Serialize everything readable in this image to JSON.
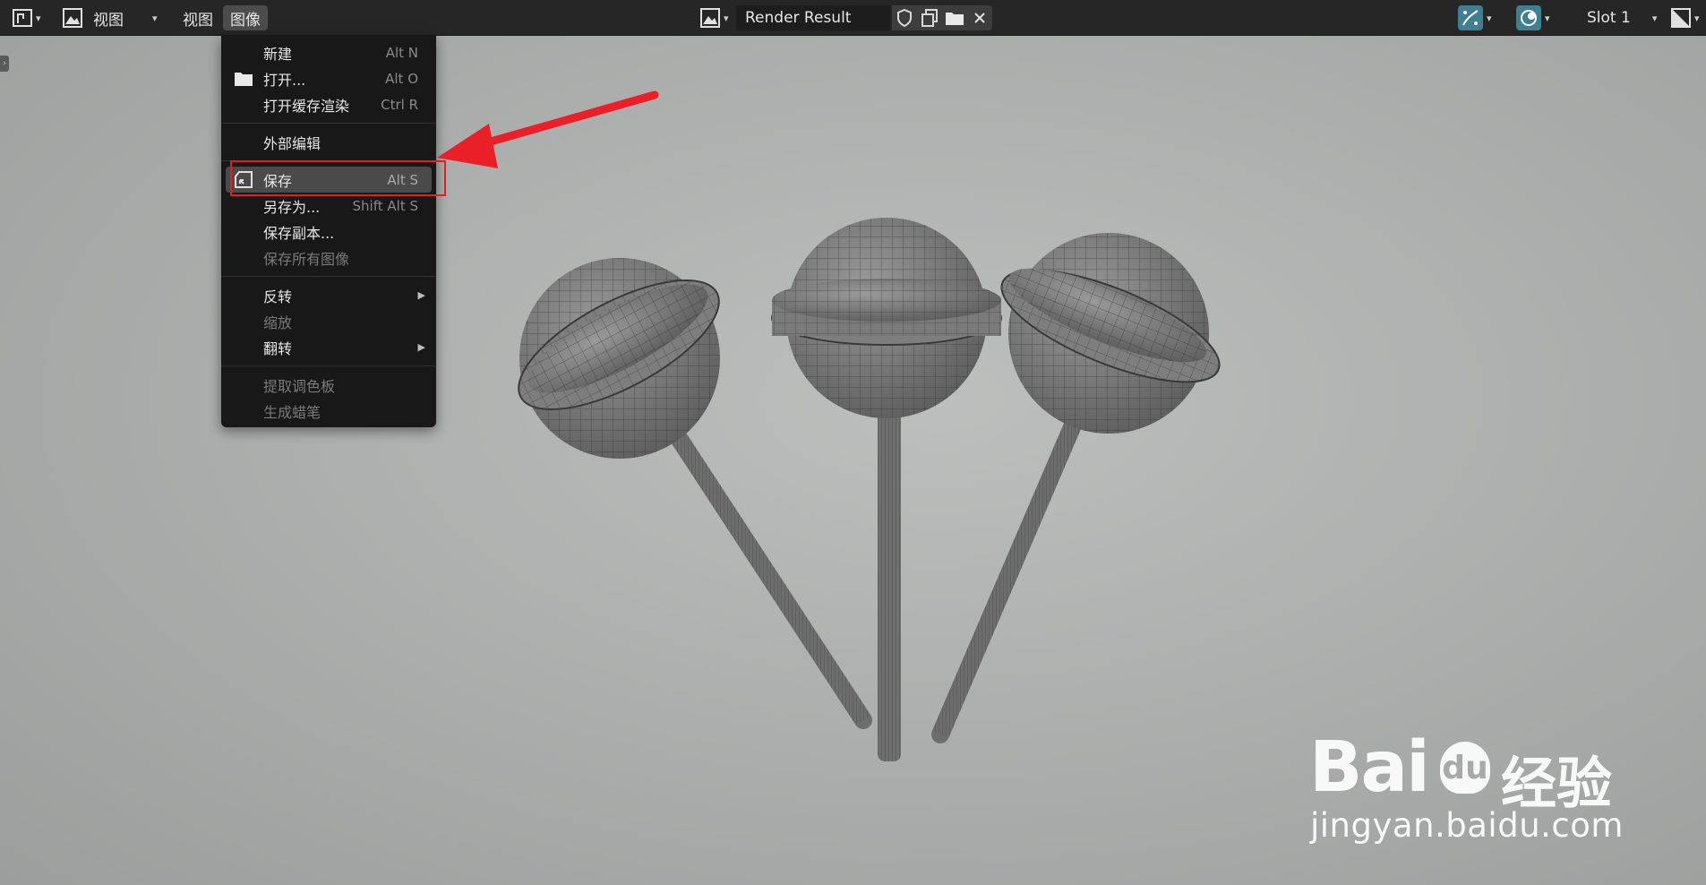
{
  "header": {
    "view_label_1": "视图",
    "view_label_2": "视图",
    "image_menu_label": "图像",
    "image_name": "Render Result",
    "slot_label": "Slot 1"
  },
  "image_menu": {
    "items": [
      {
        "label": "新建",
        "shortcut": "Alt N"
      },
      {
        "label": "打开...",
        "shortcut": "Alt O"
      },
      {
        "label": "打开缓存渲染",
        "shortcut": "Ctrl R"
      },
      {
        "label": "外部编辑",
        "shortcut": ""
      },
      {
        "label": "保存",
        "shortcut": "Alt S"
      },
      {
        "label": "另存为...",
        "shortcut": "Shift Alt S"
      },
      {
        "label": "保存副本...",
        "shortcut": ""
      },
      {
        "label": "保存所有图像",
        "shortcut": ""
      },
      {
        "label": "反转",
        "shortcut": ""
      },
      {
        "label": "缩放",
        "shortcut": ""
      },
      {
        "label": "翻转",
        "shortcut": ""
      },
      {
        "label": "提取调色板",
        "shortcut": ""
      },
      {
        "label": "生成蜡笔",
        "shortcut": ""
      }
    ]
  },
  "watermark": {
    "brand_left": "Bai",
    "brand_mid": "du",
    "brand_cn": "经验",
    "url": "jingyan.baidu.com"
  },
  "colors": {
    "header_bg": "#262626",
    "menu_bg": "#181818",
    "highlight_bg": "#4a4a4a",
    "annotation_red": "#e02020",
    "accent_teal": "#3f7f91"
  }
}
